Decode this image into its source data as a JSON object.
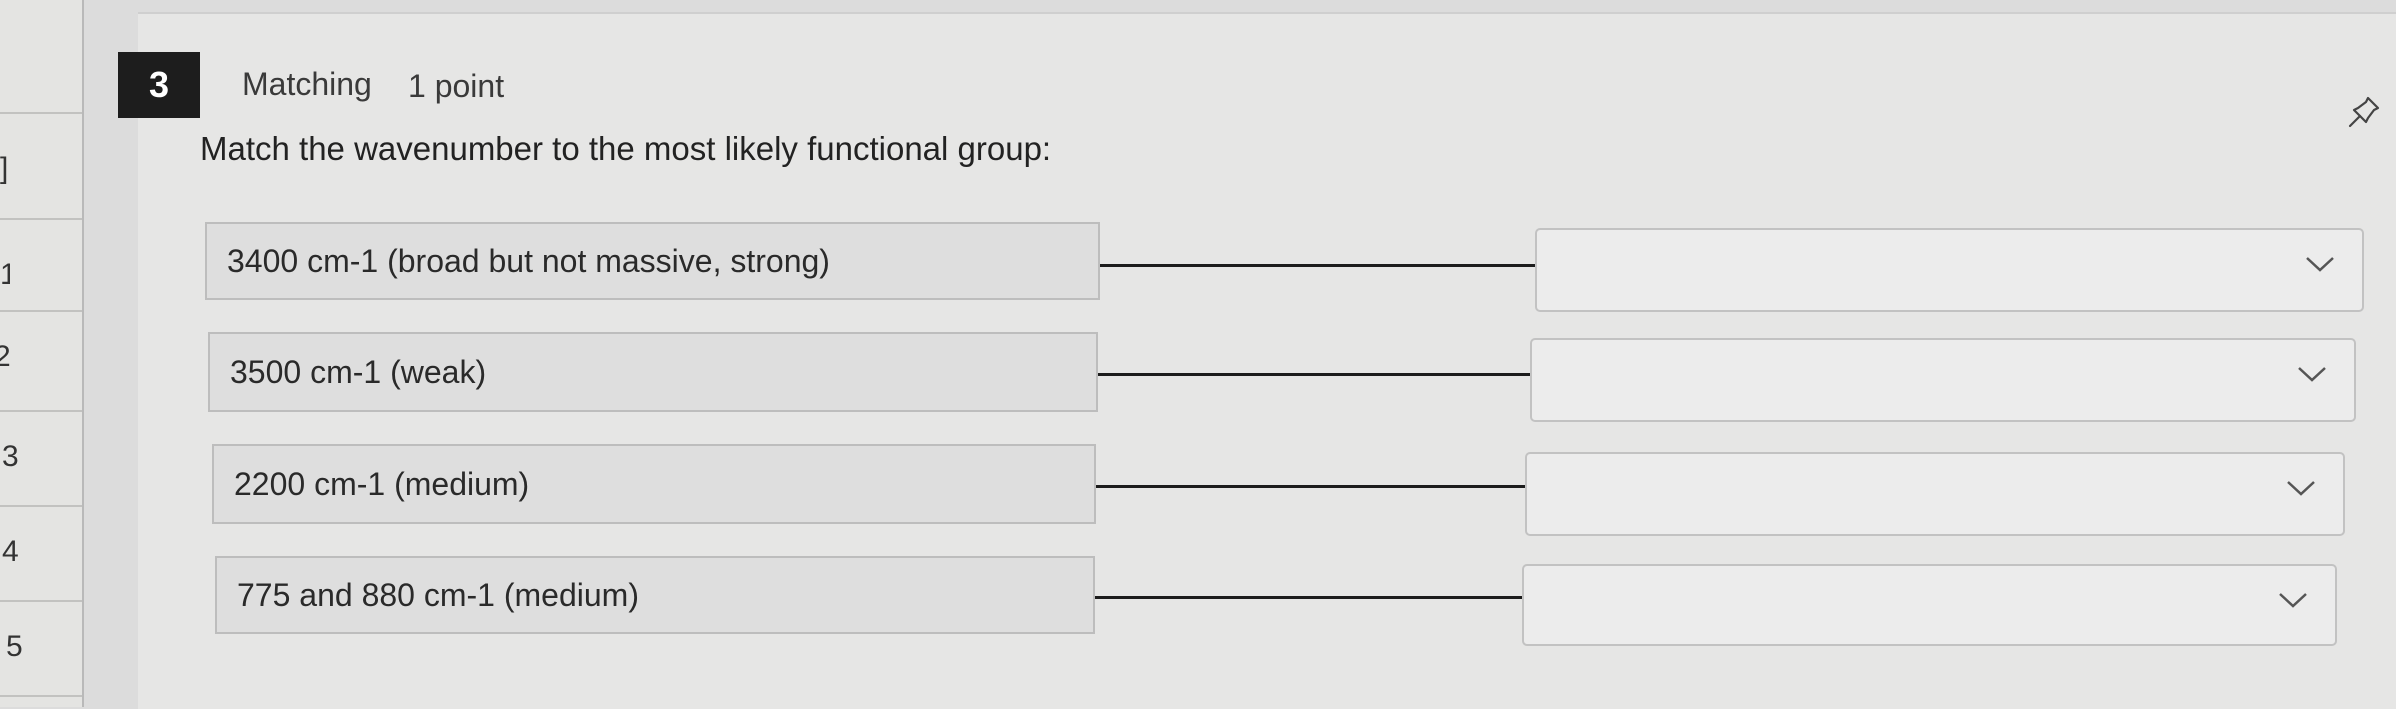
{
  "nav": {
    "numbers": [
      "2",
      "3",
      "4",
      "5"
    ]
  },
  "question": {
    "number": "3",
    "type": "Matching",
    "points": "1 point",
    "prompt": "Match the wavenumber to the most likely functional group:"
  },
  "matches": [
    {
      "premise": "3400 cm-1 (broad but not massive, strong)",
      "answer": ""
    },
    {
      "premise": "3500 cm-1 (weak)",
      "answer": ""
    },
    {
      "premise": "2200 cm-1 (medium)",
      "answer": ""
    },
    {
      "premise": "775 and 880 cm-1 (medium)",
      "answer": ""
    }
  ],
  "icons": {
    "pin": "pin-icon",
    "dropdown": "chevron-down-icon"
  }
}
